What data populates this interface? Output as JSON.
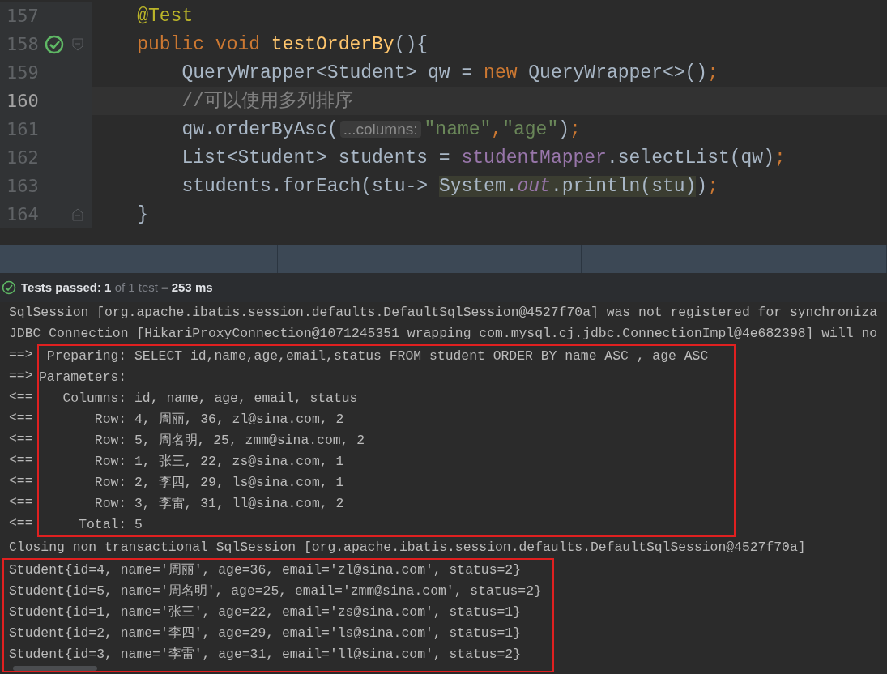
{
  "editor": {
    "lines": [
      {
        "number": "157",
        "current": false,
        "tokens": [
          {
            "kind": "annotation",
            "text": "    @Test"
          }
        ]
      },
      {
        "number": "158",
        "current": false,
        "test_passed": true,
        "fold_start": true,
        "tokens": [
          {
            "kind": "keyword",
            "text": "    public void "
          },
          {
            "kind": "method",
            "text": "testOrderBy"
          },
          {
            "kind": "plain",
            "text": "(){"
          }
        ]
      },
      {
        "number": "159",
        "current": false,
        "tokens": [
          {
            "kind": "plain",
            "text": "        QueryWrapper<Student> qw = "
          },
          {
            "kind": "keyword",
            "text": "new"
          },
          {
            "kind": "plain",
            "text": " QueryWrapper<>()"
          },
          {
            "kind": "keyword",
            "text": ";"
          }
        ]
      },
      {
        "number": "160",
        "current": true,
        "tokens": [
          {
            "kind": "comment",
            "text": "        //可以使用多列排序"
          }
        ]
      },
      {
        "number": "161",
        "current": false,
        "tokens": [
          {
            "kind": "plain",
            "text": "        qw.orderByAsc("
          },
          {
            "kind": "hint",
            "text": "...columns:"
          },
          {
            "kind": "string",
            "text": "\"name\""
          },
          {
            "kind": "keyword",
            "text": ","
          },
          {
            "kind": "string",
            "text": "\"age\""
          },
          {
            "kind": "plain",
            "text": ")"
          },
          {
            "kind": "keyword",
            "text": ";"
          }
        ]
      },
      {
        "number": "162",
        "current": false,
        "tokens": [
          {
            "kind": "plain",
            "text": "        List<Student> students = "
          },
          {
            "kind": "field",
            "text": "studentMapper"
          },
          {
            "kind": "plain",
            "text": ".selectList(qw)"
          },
          {
            "kind": "keyword",
            "text": ";"
          }
        ]
      },
      {
        "number": "163",
        "current": false,
        "tokens": [
          {
            "kind": "plain",
            "text": "        students.forEach(stu-> "
          },
          {
            "kind": "match",
            "text": "System."
          },
          {
            "kind": "match-static",
            "text": "out"
          },
          {
            "kind": "match",
            "text": ".println(stu)"
          },
          {
            "kind": "plain",
            "text": ")"
          },
          {
            "kind": "keyword",
            "text": ";"
          }
        ]
      },
      {
        "number": "164",
        "current": false,
        "fold_end": true,
        "tokens": [
          {
            "kind": "plain",
            "text": "    }"
          }
        ]
      }
    ]
  },
  "test_status": {
    "passed": true,
    "label": "Tests passed: 1",
    "count": "of 1 test",
    "duration": "– 253 ms"
  },
  "console": {
    "blocks": [
      {
        "boxed": false,
        "lines": [
          {
            "text": "SqlSession [org.apache.ibatis.session.defaults.DefaultSqlSession@4527f70a] was not registered for synchroniza"
          },
          {
            "text": "JDBC Connection [HikariProxyConnection@1071245351 wrapping com.mysql.cj.jdbc.ConnectionImpl@4e682398] will no"
          }
        ]
      },
      {
        "boxed": true,
        "lines": [
          {
            "prefix": "==>",
            "text": " Preparing: SELECT id,name,age,email,status FROM student ORDER BY name ASC , age ASC"
          },
          {
            "prefix": "==>",
            "text": "Parameters: "
          },
          {
            "prefix": "<==",
            "text": "   Columns: id, name, age, email, status"
          },
          {
            "prefix": "<==",
            "text": "       Row: 4, 周丽, 36, zl@sina.com, 2"
          },
          {
            "prefix": "<==",
            "text": "       Row: 5, 周名明, 25, zmm@sina.com, 2"
          },
          {
            "prefix": "<==",
            "text": "       Row: 1, 张三, 22, zs@sina.com, 1"
          },
          {
            "prefix": "<==",
            "text": "       Row: 2, 李四, 29, ls@sina.com, 1"
          },
          {
            "prefix": "<==",
            "text": "       Row: 3, 李雷, 31, ll@sina.com, 2"
          },
          {
            "prefix": "<==",
            "text": "     Total: 5"
          }
        ]
      },
      {
        "boxed": false,
        "lines": [
          {
            "text": "Closing non transactional SqlSession [org.apache.ibatis.session.defaults.DefaultSqlSession@4527f70a]"
          }
        ]
      },
      {
        "boxed": true,
        "lines": [
          {
            "text": "Student{id=4, name='周丽', age=36, email='zl@sina.com', status=2}"
          },
          {
            "text": "Student{id=5, name='周名明', age=25, email='zmm@sina.com', status=2}"
          },
          {
            "text": "Student{id=1, name='张三', age=22, email='zs@sina.com', status=1}"
          },
          {
            "text": "Student{id=2, name='李四', age=29, email='ls@sina.com', status=1}"
          },
          {
            "text": "Student{id=3, name='李雷', age=31, email='ll@sina.com', status=2}"
          }
        ]
      }
    ]
  }
}
